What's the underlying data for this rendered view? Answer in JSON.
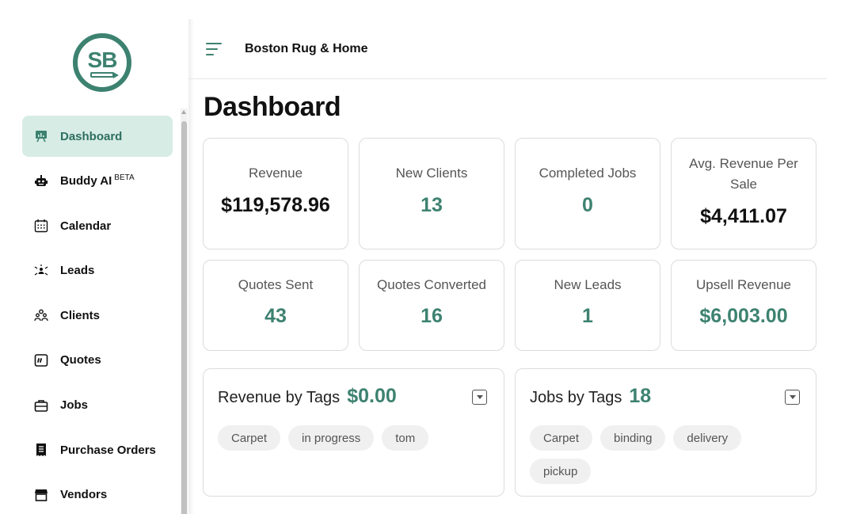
{
  "sidebar": {
    "logo_text": "SB",
    "items": [
      {
        "label": "Dashboard",
        "icon": "chart-board-icon",
        "active": true
      },
      {
        "label": "Buddy AI",
        "badge": "BETA",
        "icon": "robot-icon"
      },
      {
        "label": "Calendar",
        "icon": "calendar-icon"
      },
      {
        "label": "Leads",
        "icon": "leads-icon"
      },
      {
        "label": "Clients",
        "icon": "clients-icon"
      },
      {
        "label": "Quotes",
        "icon": "quote-icon"
      },
      {
        "label": "Jobs",
        "icon": "briefcase-icon"
      },
      {
        "label": "Purchase Orders",
        "icon": "receipt-icon"
      },
      {
        "label": "Vendors",
        "icon": "store-icon"
      }
    ]
  },
  "header": {
    "company": "Boston Rug & Home"
  },
  "page": {
    "title": "Dashboard"
  },
  "stats": [
    {
      "label": "Revenue",
      "value": "$119,578.96",
      "color": "#111111"
    },
    {
      "label": "New Clients",
      "value": "13",
      "color": "#3d8270"
    },
    {
      "label": "Completed Jobs",
      "value": "0",
      "color": "#3d8270"
    },
    {
      "label": "Avg. Revenue Per Sale",
      "value": "$4,411.07",
      "color": "#111111"
    },
    {
      "label": "Quotes Sent",
      "value": "43",
      "color": "#3d8270"
    },
    {
      "label": "Quotes Converted",
      "value": "16",
      "color": "#3d8270"
    },
    {
      "label": "New Leads",
      "value": "1",
      "color": "#3d8270"
    },
    {
      "label": "Upsell Revenue",
      "value": "$6,003.00",
      "color": "#3d8270"
    }
  ],
  "revenue_by_tags": {
    "title": "Revenue by Tags",
    "value": "$0.00",
    "tags": [
      "Carpet",
      "in progress",
      "tom"
    ]
  },
  "jobs_by_tags": {
    "title": "Jobs by Tags",
    "value": "18",
    "tags": [
      "Carpet",
      "binding",
      "delivery",
      "pickup"
    ]
  },
  "colors": {
    "brand": "#3d8270",
    "active_bg": "#d7ece5"
  }
}
